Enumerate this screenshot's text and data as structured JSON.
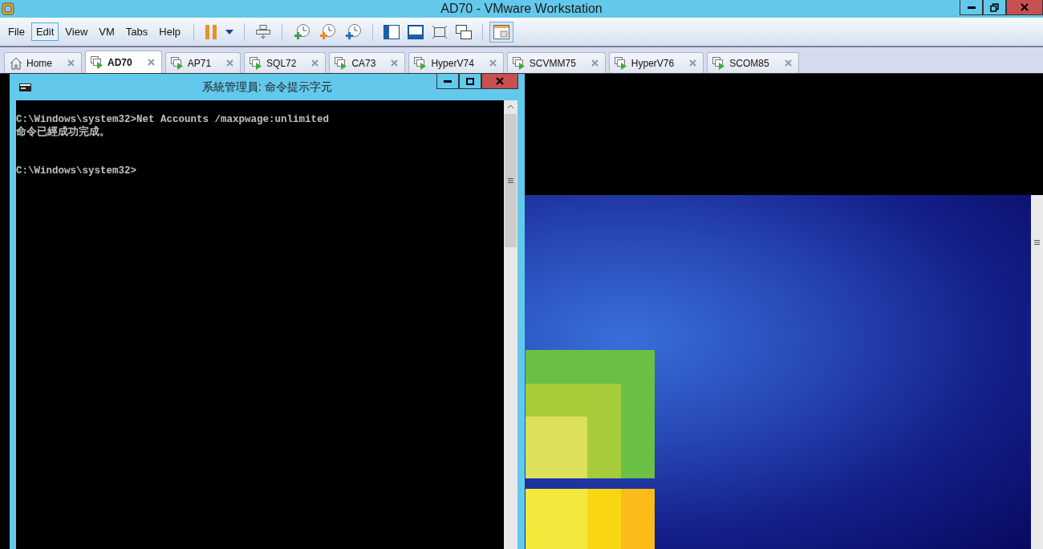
{
  "window": {
    "title": "AD70 - VMware Workstation"
  },
  "menu": [
    {
      "label": "File",
      "selected": false
    },
    {
      "label": "Edit",
      "selected": true
    },
    {
      "label": "View",
      "selected": false
    },
    {
      "label": "VM",
      "selected": false
    },
    {
      "label": "Tabs",
      "selected": false
    },
    {
      "label": "Help",
      "selected": false
    }
  ],
  "toolbar": [
    {
      "kind": "pause",
      "pressed": false
    },
    {
      "kind": "dropdown",
      "pressed": false
    },
    {
      "kind": "sep"
    },
    {
      "kind": "keys",
      "pressed": false
    },
    {
      "kind": "sep"
    },
    {
      "kind": "snap-take",
      "pressed": false
    },
    {
      "kind": "snap-revert",
      "pressed": false
    },
    {
      "kind": "snap-manage",
      "pressed": false
    },
    {
      "kind": "sep"
    },
    {
      "kind": "sidebar",
      "pressed": false
    },
    {
      "kind": "console",
      "pressed": false
    },
    {
      "kind": "fullscreen",
      "pressed": false
    },
    {
      "kind": "unity",
      "pressed": false
    },
    {
      "kind": "sep"
    },
    {
      "kind": "view",
      "pressed": true
    }
  ],
  "tabs": [
    {
      "label": "Home",
      "kind": "home",
      "selected": false
    },
    {
      "label": "AD70",
      "kind": "vm",
      "selected": true
    },
    {
      "label": "AP71",
      "kind": "vm",
      "selected": false
    },
    {
      "label": "SQL72",
      "kind": "vm",
      "selected": false
    },
    {
      "label": "CA73",
      "kind": "vm",
      "selected": false
    },
    {
      "label": "HyperV74",
      "kind": "vm",
      "selected": false
    },
    {
      "label": "SCVMM75",
      "kind": "vm",
      "selected": false
    },
    {
      "label": "HyperV76",
      "kind": "vm",
      "selected": false
    },
    {
      "label": "SCOM85",
      "kind": "vm",
      "selected": false
    }
  ],
  "console_window": {
    "title": "系統管理員: 命令提示字元",
    "blocks": [
      [
        "C:\\Windows\\system32>Net Accounts /maxpwage:unlimited",
        "命令已經成功完成。"
      ],
      [
        "C:\\Windows\\system32>"
      ]
    ]
  }
}
